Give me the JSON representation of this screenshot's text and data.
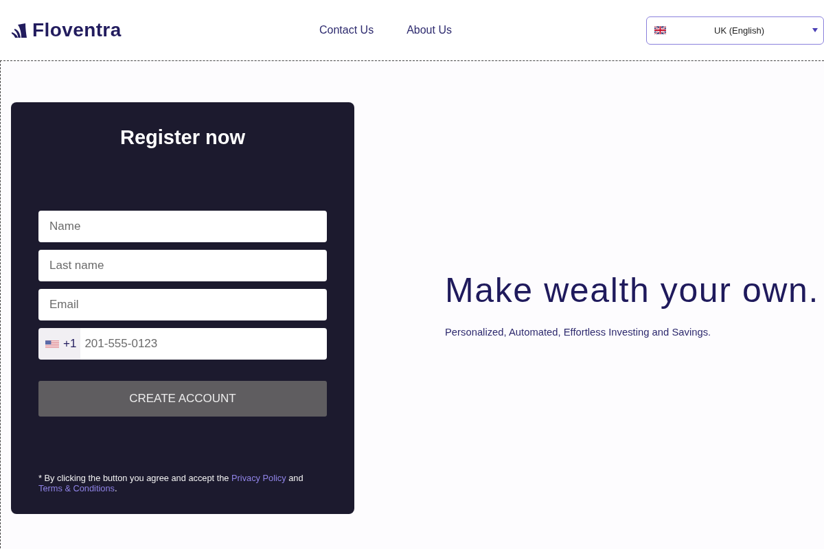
{
  "header": {
    "brand": "Floventra",
    "nav": [
      {
        "label": "Contact Us"
      },
      {
        "label": "About Us"
      }
    ],
    "language": {
      "value": "UK (English)"
    }
  },
  "register": {
    "title": "Register now",
    "fields": [
      {
        "kind": "text",
        "placeholder": "Name"
      },
      {
        "kind": "text",
        "placeholder": "Last name"
      },
      {
        "kind": "text",
        "placeholder": "Email"
      },
      {
        "kind": "phone",
        "dial_code": "+1",
        "placeholder": "201-555-0123"
      }
    ],
    "submit": "CREATE ACCOUNT",
    "disclaimer": [
      {
        "kind": "text",
        "text": "* By clicking the button you agree and accept the "
      },
      {
        "kind": "link",
        "text": "Privacy Policy"
      },
      {
        "kind": "text",
        "text": " and "
      },
      {
        "kind": "link",
        "text": "Terms & Conditions"
      },
      {
        "kind": "text",
        "text": "."
      }
    ]
  },
  "hero": {
    "headline": "Make wealth your own.",
    "subtitle": "Personalized, Automated, Effortless Investing and Savings."
  }
}
